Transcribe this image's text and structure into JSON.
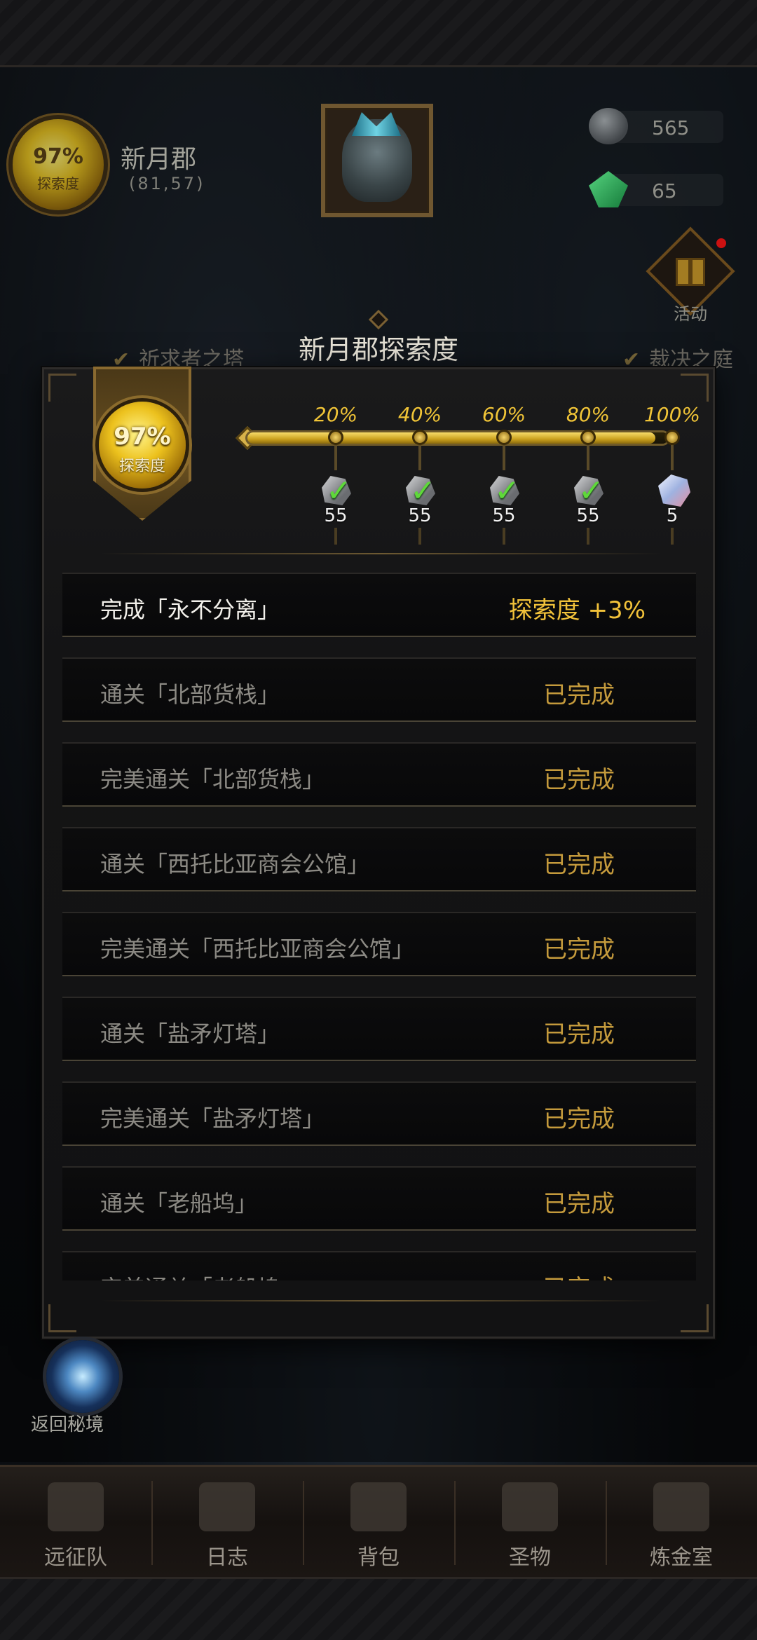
{
  "hud": {
    "compass_pct": "97%",
    "compass_label": "探索度",
    "region_name": "新月郡",
    "region_coord": "(81,57)",
    "resources": [
      {
        "icon": "stone-icon",
        "value": "565"
      },
      {
        "icon": "green-gem-icon",
        "value": "65"
      }
    ],
    "activity_label": "活动",
    "side_tags": [
      "祈求者之塔",
      "裁决之庭"
    ]
  },
  "panel": {
    "title": "新月郡探索度",
    "progress_pct": "97%",
    "progress_label": "探索度",
    "progress_value": 0.97,
    "milestones": [
      {
        "label": "20%",
        "reward": "ore-icon",
        "qty": "55",
        "claimed": true
      },
      {
        "label": "40%",
        "reward": "ore-icon",
        "qty": "55",
        "claimed": true
      },
      {
        "label": "60%",
        "reward": "ore-icon",
        "qty": "55",
        "claimed": true
      },
      {
        "label": "80%",
        "reward": "ore-icon",
        "qty": "55",
        "claimed": true
      },
      {
        "label": "100%",
        "reward": "crystal-icon",
        "qty": "5",
        "claimed": false
      }
    ],
    "tasks": [
      {
        "name": "完成「永不分离」",
        "status": "探索度 +3%",
        "active": true
      },
      {
        "name": "通关「北部货栈」",
        "status": "已完成",
        "active": false
      },
      {
        "name": "完美通关「北部货栈」",
        "status": "已完成",
        "active": false
      },
      {
        "name": "通关「西托比亚商会公馆」",
        "status": "已完成",
        "active": false
      },
      {
        "name": "完美通关「西托比亚商会公馆」",
        "status": "已完成",
        "active": false
      },
      {
        "name": "通关「盐矛灯塔」",
        "status": "已完成",
        "active": false
      },
      {
        "name": "完美通关「盐矛灯塔」",
        "status": "已完成",
        "active": false
      },
      {
        "name": "通关「老船坞」",
        "status": "已完成",
        "active": false
      },
      {
        "name": "完美通关「老船坞」",
        "status": "已完成",
        "active": false
      }
    ]
  },
  "return_label": "返回秘境",
  "nav": [
    {
      "label": "远征队",
      "icon": "helmet-icon"
    },
    {
      "label": "日志",
      "icon": "scroll-icon"
    },
    {
      "label": "背包",
      "icon": "bag-icon"
    },
    {
      "label": "圣物",
      "icon": "torch-icon"
    },
    {
      "label": "炼金室",
      "icon": "alchemy-icon"
    }
  ]
}
